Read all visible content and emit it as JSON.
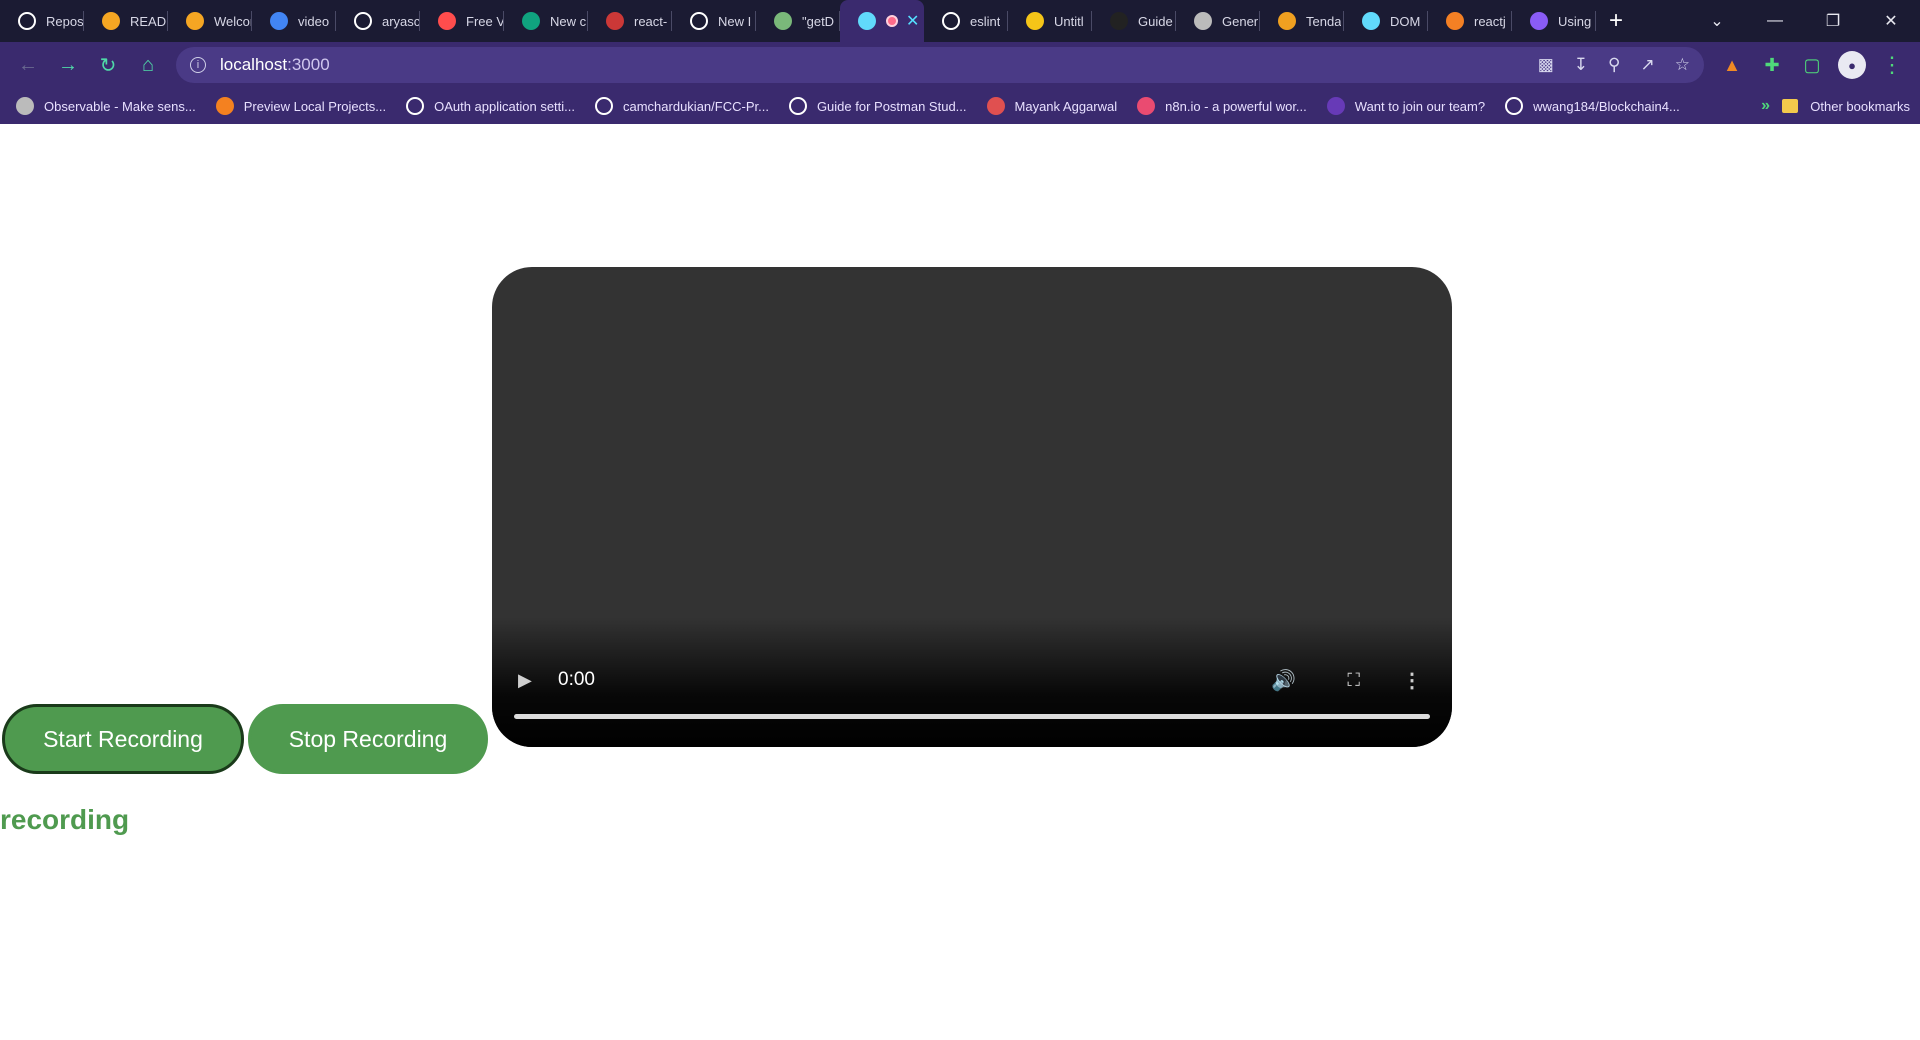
{
  "tabs": [
    {
      "label": "Repos",
      "icon": "github-icon",
      "color": "#ffffff"
    },
    {
      "label": "README",
      "icon": "gitbook-icon",
      "color": "#f5a623"
    },
    {
      "label": "Welcome",
      "icon": "gitbook-icon",
      "color": "#f5a623"
    },
    {
      "label": "video",
      "icon": "google-icon",
      "color": "#4285f4"
    },
    {
      "label": "aryasc",
      "icon": "github-icon",
      "color": "#ffffff"
    },
    {
      "label": "Free V",
      "icon": "youtube-icon",
      "color": "#ff4d4d"
    },
    {
      "label": "New c",
      "icon": "chatgpt-icon",
      "color": "#10a37f"
    },
    {
      "label": "react-",
      "icon": "npm-icon",
      "color": "#cb3837"
    },
    {
      "label": "New I",
      "icon": "github-icon",
      "color": "#ffffff"
    },
    {
      "label": "\"getD",
      "icon": "image-icon",
      "color": "#7ab87a"
    },
    {
      "label": "",
      "icon": "react-icon",
      "color": "#61dafb",
      "active": true
    },
    {
      "label": "eslint",
      "icon": "github-icon",
      "color": "#ffffff"
    },
    {
      "label": "Untitl",
      "icon": "smiley-icon",
      "color": "#f5c518"
    },
    {
      "label": "Guide",
      "icon": "dark-icon",
      "color": "#222222"
    },
    {
      "label": "Gener",
      "icon": "globe-icon",
      "color": "#bbbbbb"
    },
    {
      "label": "Tenda",
      "icon": "flower-icon",
      "color": "#f0a020"
    },
    {
      "label": "DOM",
      "icon": "react-icon",
      "color": "#61dafb"
    },
    {
      "label": "reactj",
      "icon": "stackoverflow-icon",
      "color": "#f48024"
    },
    {
      "label": "Using",
      "icon": "astro-icon",
      "color": "#8a5cf6"
    }
  ],
  "address": {
    "host": "localhost",
    "port": ":3000"
  },
  "bookmarks": [
    {
      "label": "Observable - Make sens...",
      "icon": "observable-icon",
      "color": "#bbbbbb"
    },
    {
      "label": "Preview Local Projects...",
      "icon": "cloudflare-icon",
      "color": "#f48120"
    },
    {
      "label": "OAuth application setti...",
      "icon": "github-icon",
      "color": "#ffffff"
    },
    {
      "label": "camchardukian/FCC-Pr...",
      "icon": "github-icon",
      "color": "#ffffff"
    },
    {
      "label": "Guide for Postman Stud...",
      "icon": "notion-icon",
      "color": "#ffffff"
    },
    {
      "label": "Mayank Aggarwal",
      "icon": "avatar-icon",
      "color": "#e05050"
    },
    {
      "label": "n8n.io - a powerful wor...",
      "icon": "n8n-icon",
      "color": "#ea4b71"
    },
    {
      "label": "Want to join our team?",
      "icon": "form-icon",
      "color": "#673ab7"
    },
    {
      "label": "wwang184/Blockchain4...",
      "icon": "github-icon",
      "color": "#ffffff"
    }
  ],
  "bookmarks_other": "Other bookmarks",
  "video": {
    "time": "0:00"
  },
  "buttons": {
    "start": "Start Recording",
    "stop": "Stop Recording"
  },
  "status": "recording",
  "colors": {
    "accent_green": "#4f9a4f",
    "browser_purple": "#3a2a6e",
    "tabstrip_dark": "#1b1b33"
  }
}
